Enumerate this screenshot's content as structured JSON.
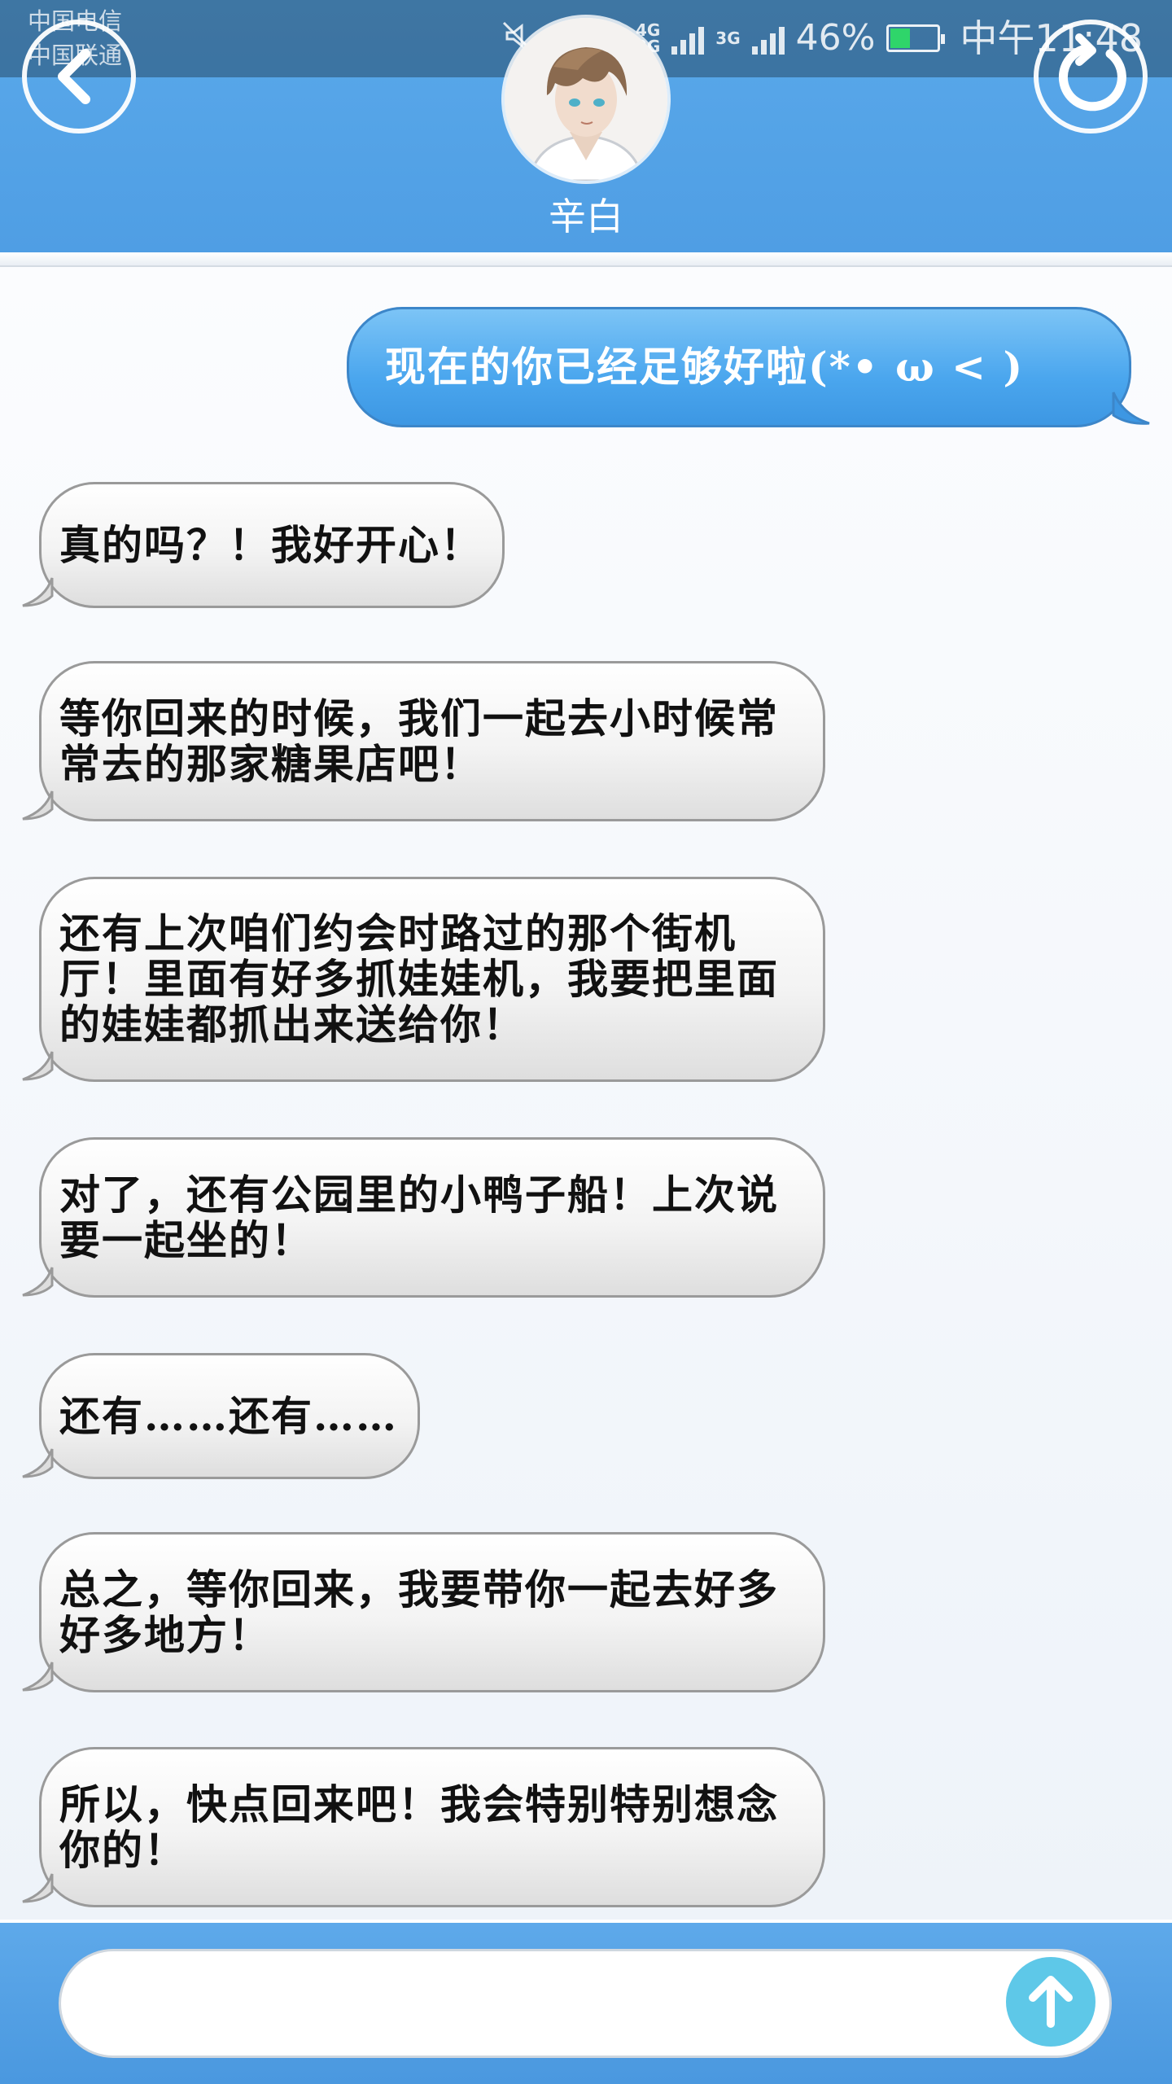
{
  "status_bar": {
    "carrier_1": "中国电信",
    "carrier_2": "中国联通",
    "network_tag_1": "4G\n2G",
    "network_tag_2": "3G",
    "battery_percent": "46%",
    "battery_level": 0.46,
    "time": "中午11:48",
    "icons": [
      "mute-icon",
      "alarm-icon",
      "wifi-icon",
      "signal-icon",
      "battery-icon"
    ]
  },
  "header": {
    "contact_name": "辛白",
    "back_icon": "chevron-left-icon",
    "refresh_icon": "refresh-icon"
  },
  "messages": [
    {
      "from": "me",
      "text": "现在的你已经足够好啦(*• ω < )"
    },
    {
      "from": "contact",
      "text": "真的吗？！我好开心！"
    },
    {
      "from": "contact",
      "text": "等你回来的时候，我们一起去小时候常常去的那家糖果店吧！"
    },
    {
      "from": "contact",
      "text": "还有上次咱们约会时路过的那个街机厅！里面有好多抓娃娃机，我要把里面的娃娃都抓出来送给你！"
    },
    {
      "from": "contact",
      "text": "对了，还有公园里的小鸭子船！上次说要一起坐的！"
    },
    {
      "from": "contact",
      "text": "还有……还有……"
    },
    {
      "from": "contact",
      "text": "总之，等你回来，我要带你一起去好多好多地方！"
    },
    {
      "from": "contact",
      "text": "所以，快点回来吧！我会特别特别想念你的！"
    }
  ],
  "input": {
    "value": "",
    "placeholder": "",
    "send_icon": "arrow-up-icon"
  },
  "colors": {
    "header_blue": "#5aa9ea",
    "outgoing_bubble": "#4aa6ee",
    "send_button": "#5ec8e8"
  }
}
